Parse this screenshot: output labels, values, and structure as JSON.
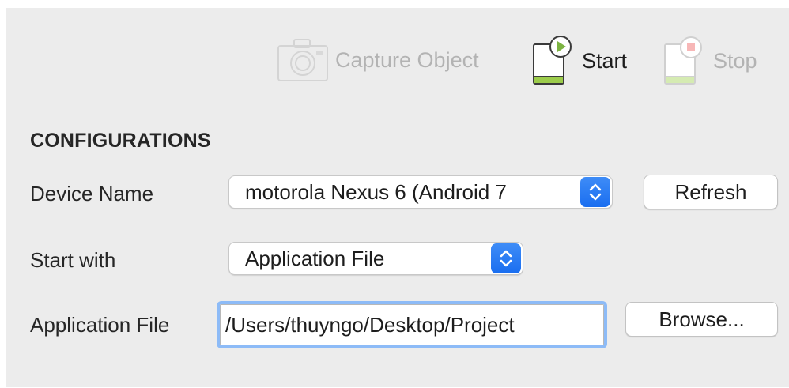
{
  "toolbar": {
    "capture_label": "Capture Object",
    "start_label": "Start",
    "stop_label": "Stop"
  },
  "config": {
    "title": "CONFIGURATIONS",
    "device_name_label": "Device Name",
    "device_value": "motorola Nexus 6 (Android 7",
    "refresh_label": "Refresh",
    "start_with_label": "Start with",
    "start_with_value": "Application File",
    "app_file_label": "Application File",
    "app_file_value": "/Users/thuyngo/Desktop/Project",
    "browse_label": "Browse..."
  },
  "colors": {
    "accent_blue": "#1a6ef0",
    "phone_green": "#9ccc4b",
    "play_green": "#7cb342",
    "stop_red": "#f28b8b",
    "focus_ring": "#8dbbf7"
  },
  "icons": {
    "capture": "camera-icon",
    "start": "device-start-icon",
    "stop": "device-stop-icon",
    "stepper": "updown-chevron-icon"
  }
}
